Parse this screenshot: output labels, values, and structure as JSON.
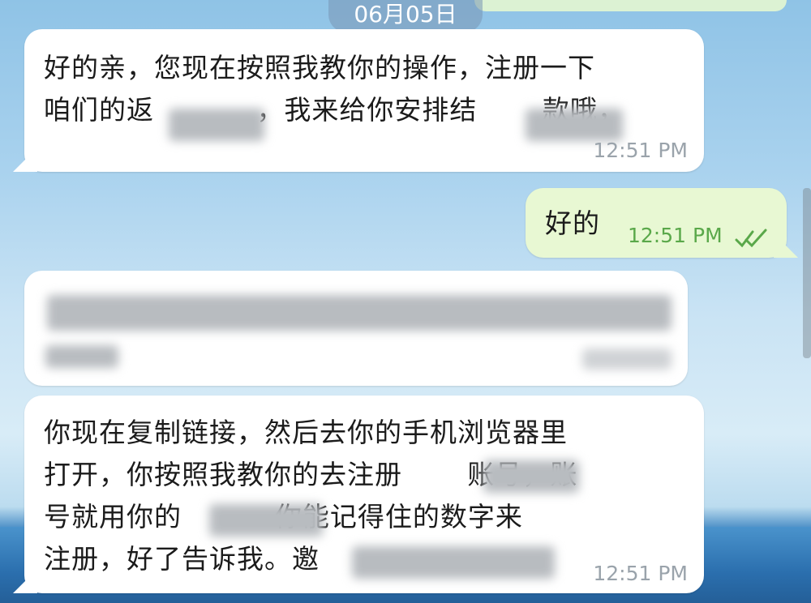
{
  "date_header": "06月05日",
  "messages": [
    {
      "direction": "in",
      "text": "好的亲，您现在按照我教你的操作，注册一下\n咱们的返           ，我来给你安排结       款哦，",
      "time": "12:51 PM"
    },
    {
      "direction": "out",
      "text": "好的",
      "time": "12:51 PM",
      "status": "read",
      "status_icon": "double-check-icon"
    },
    {
      "direction": "in",
      "type": "link-preview",
      "text": "",
      "time": ""
    },
    {
      "direction": "in",
      "text": "你现在复制链接，然后去你的手机浏览器里\n打开，你按照我教你的去注册       账号，账\n号就用你的          你能记得住的数字来\n注册，好了告诉我。邀",
      "time": "12:51 PM"
    }
  ],
  "colors": {
    "incoming_bubble": "#ffffff",
    "outgoing_bubble": "#e8f8d3",
    "outgoing_time": "#5aa84a",
    "incoming_time": "#9aa3ab"
  }
}
